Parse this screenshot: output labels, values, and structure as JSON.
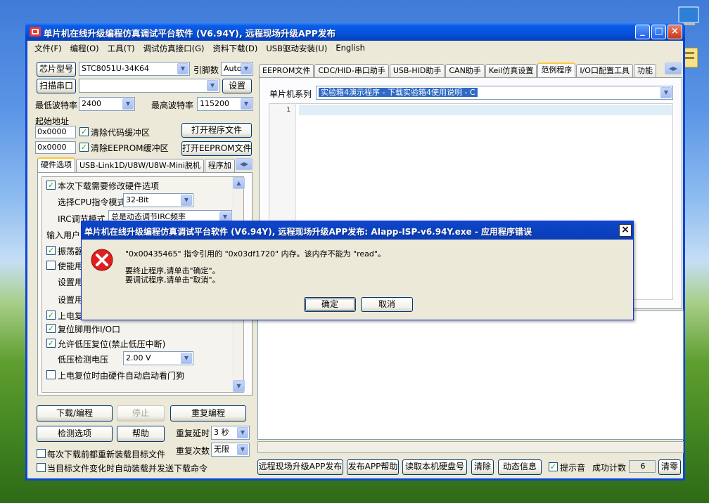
{
  "window": {
    "title": "单片机在线升级编程仿真调试平台软件 (V6.94Y), 远程现场升级APP发布"
  },
  "menu": [
    "文件(F)",
    "编程(O)",
    "工具(T)",
    "调试仿真接口(G)",
    "资料下载(D)",
    "USB驱动安装(U)",
    "English"
  ],
  "left": {
    "chip_btn": "芯片型号",
    "chip_value": "STC8051U-34K64",
    "pin_label": "引脚数",
    "pin_value": "Auto",
    "scan_btn": "扫描串口",
    "settings_btn": "设置",
    "min_baud_label": "最低波特率",
    "min_baud": "2400",
    "max_baud_label": "最高波特率",
    "max_baud": "115200",
    "start_addr_label": "起始地址",
    "addr1": "0x0000",
    "clear_code": "清除代码缓冲区",
    "open_prog": "打开程序文件",
    "addr2": "0x0000",
    "clear_eeprom": "清除EEPROM缓冲区",
    "open_eeprom": "打开EEPROM文件",
    "tabs": [
      "硬件选项",
      "USB-Link1D/U8W/U8W-Mini脱机",
      "程序加"
    ],
    "options": {
      "modify_hw": "本次下载需要修改硬件选项",
      "cpu_mode_label": "选择CPU指令模式",
      "cpu_mode": "32-Bit",
      "irc_label": "IRC调节模式",
      "irc_value": "总是动态调节IRC频率",
      "input_user": "输入用户",
      "osc": "振荡器",
      "enable": "使能用",
      "set1": "设置用",
      "set2": "设置用",
      "poweron": "上电复",
      "reset_io": "复位脚用作I/O口",
      "low_volt_reset": "允许低压复位(禁止低压中断)",
      "low_volt_label": "低压检测电压",
      "low_volt_value": "2.00 V",
      "watchdog": "上电复位时由硬件自动启动看门狗"
    },
    "download_btn": "下载/编程",
    "stop_btn": "停止",
    "repeat_btn": "重复编程",
    "check_btn": "检测选项",
    "help_btn": "帮助",
    "delay_label": "重复延时",
    "delay_value": "3 秒",
    "count_label": "重复次数",
    "count_value": "无限",
    "reload_each": "每次下载前都重新装载目标文件",
    "auto_reload": "当目标文件变化时自动装载并发送下载命令"
  },
  "right": {
    "tabs": [
      "EEPROM文件",
      "CDC/HID-串口助手",
      "USB-HID助手",
      "CAN助手",
      "Keil仿真设置",
      "范例程序",
      "I/O口配置工具",
      "功能"
    ],
    "series_label": "单片机系列",
    "series_value": "实验箱4演示程序 - 下载实验箱4使用说明 - C",
    "line_no": "1"
  },
  "bottom": {
    "publish_btn": "远程现场升级APP发布",
    "app_help_btn": "发布APP帮助",
    "read_disk_btn": "读取本机硬盘号",
    "clear_btn": "清除",
    "dyn_info_btn": "动态信息",
    "sound_label": "提示音",
    "success_label": "成功计数",
    "success_count": "6",
    "reset_btn": "清零"
  },
  "dialog": {
    "title": "单片机在线升级编程仿真调试平台软件 (V6.94Y), 远程现场升级APP发布: AIapp-ISP-v6.94Y.exe - 应用程序错误",
    "line1": "\"0x00435465\" 指令引用的 \"0x03df1720\" 内存。该内存不能为 \"read\"。",
    "line2": "要终止程序,请单击\"确定\"。",
    "line3": "要调试程序,请单击\"取消\"。",
    "ok_btn": "确定",
    "cancel_btn": "取消"
  },
  "colors": {
    "title_blue": "#0655e0",
    "error_red": "#e01e1e",
    "selection": "#316ac5"
  }
}
